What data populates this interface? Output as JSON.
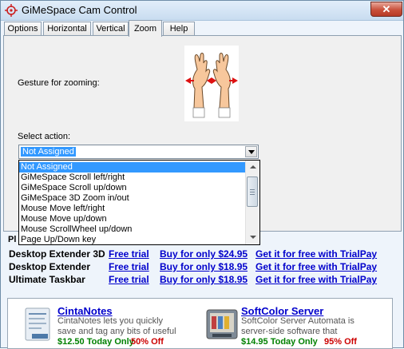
{
  "window": {
    "title": "GiMeSpace Cam Control",
    "close_label": "✕"
  },
  "tabs": [
    {
      "label": "Options",
      "active": false
    },
    {
      "label": "Horizontal",
      "active": false
    },
    {
      "label": "Vertical",
      "active": false
    },
    {
      "label": "Zoom",
      "active": true
    },
    {
      "label": "Help",
      "active": false
    }
  ],
  "zoom_panel": {
    "gesture_label": "Gesture for zooming:",
    "select_label": "Select action:",
    "selected_value": "Not Assigned",
    "dropdown_options": [
      "Not Assigned",
      "GiMeSpace Scroll left/right",
      "GiMeSpace Scroll up/down",
      "GiMeSpace 3D Zoom in/out",
      "Mouse Move left/right",
      "Mouse Move up/down",
      "Mouse ScrollWheel up/down",
      "Page Up/Down key"
    ],
    "highlighted_index": 0
  },
  "products_section": {
    "label": "Pl",
    "rows": [
      {
        "name": "Desktop Extender 3D",
        "free_trial": "Free trial",
        "buy": "Buy for only $24.95",
        "trialpay": "Get it for free with TrialPay"
      },
      {
        "name": "Desktop Extender",
        "free_trial": "Free trial",
        "buy": "Buy for only $18.95",
        "trialpay": "Get it for free with TrialPay"
      },
      {
        "name": "Ultimate Taskbar",
        "free_trial": "Free trial",
        "buy": "Buy for only $18.95",
        "trialpay": "Get it for free with TrialPay"
      }
    ]
  },
  "ads": [
    {
      "title": "CintaNotes",
      "desc1": "CintaNotes lets you quickly",
      "desc2": "save and tag any bits of useful",
      "price": "$12.50 Today Only",
      "off": "50% Off",
      "icon": "notes-icon"
    },
    {
      "title": "SoftColor Server",
      "desc1": "SoftColor Server Automata is",
      "desc2": "server-side software that",
      "price": "$14.95 Today Only",
      "off": "95% Off",
      "icon": "server-icon"
    }
  ],
  "colors": {
    "link": "#0000cc",
    "selection": "#3399ff",
    "price": "#008000",
    "discount": "#cc0000",
    "close_button": "#c9503b"
  }
}
